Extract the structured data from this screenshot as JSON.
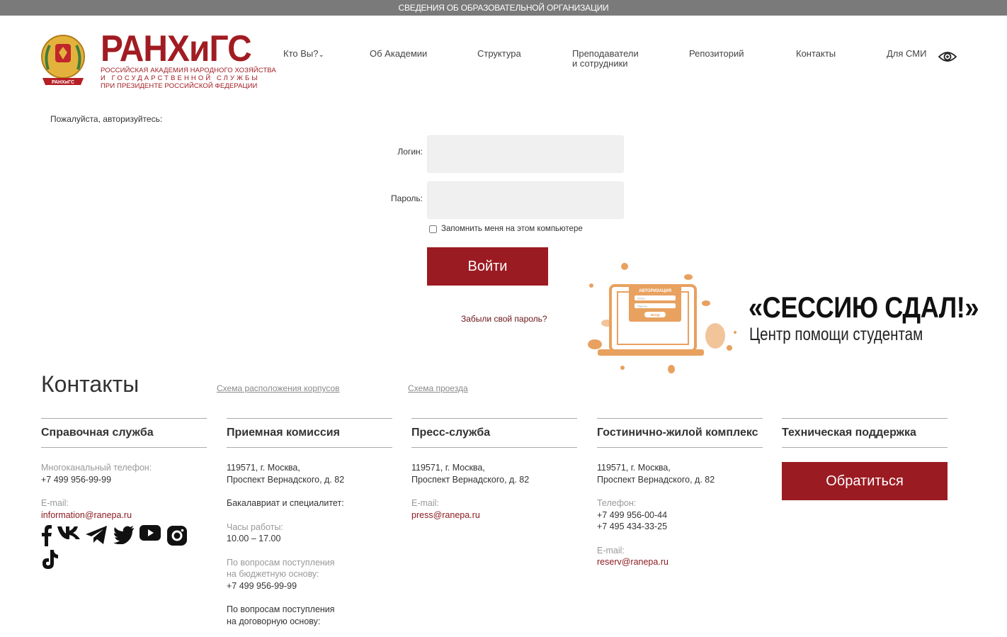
{
  "topbar": {
    "text": "СВЕДЕНИЯ ОБ ОБРАЗОВАТЕЛЬНОЙ ОРГАНИЗАЦИИ"
  },
  "logo": {
    "word": "РАНХиГС",
    "line1": "РОССИЙСКАЯ АКАДЕМИЯ НАРОДНОГО ХОЗЯЙСТВА",
    "line2": "И ГОСУДАРСТВЕННОЙ СЛУЖБЫ",
    "line3": "ПРИ ПРЕЗИДЕНТЕ РОССИЙСКОЙ ФЕДЕРАЦИИ",
    "emblem_text": "РАНХиГС"
  },
  "nav": {
    "who": "Кто Вы?",
    "about": "Об Академии",
    "structure": "Структура",
    "staff_line1": "Преподаватели",
    "staff_line2": "и сотрудники",
    "repository": "Репозиторий",
    "contacts": "Контакты",
    "media": "Для СМИ",
    "accessibility_icon": "eye-icon"
  },
  "auth": {
    "hint": "Пожалуйста, авторизуйтесь:",
    "login_label": "Логин:",
    "password_label": "Пароль:",
    "login_value": "",
    "password_value": "",
    "remember_label": "Запомнить меня на этом компьютере",
    "remember_checked": false,
    "submit": "Войти",
    "forgot": "Забыли свой пароль?"
  },
  "promo": {
    "title": "«СЕССИЮ СДАЛ!»",
    "subtitle": "Центр помощи студентам",
    "illustration": {
      "header": "АВТОРИЗАЦИЯ",
      "field1": "Логин",
      "field2": "Пароль",
      "button": "ВХОД"
    }
  },
  "contacts": {
    "title": "Контакты",
    "link_buildings": "Схема расположения корпусов",
    "link_directions": "Схема проезда",
    "info": {
      "title": "Справочная служба",
      "phone_label": "Многоканальный телефон:",
      "phone": "+7 499 956-99-99",
      "email_label": "E-mail:",
      "email": "information@ranepa.ru"
    },
    "admission": {
      "title": "Приемная комиссия",
      "addr1": "119571, г. Москва,",
      "addr2": "Проспект Вернадского, д. 82",
      "bachelor": "Бакалавриат и специалитет:",
      "hours_label": "Часы работы:",
      "hours": "10.00 – 17.00",
      "budget_label1": "По вопросам поступления",
      "budget_label2": "на бюджетную основу:",
      "budget_phone": "+7 499 956-99-99",
      "contract_label1": "По вопросам поступления",
      "contract_label2": "на договорную основу:"
    },
    "press": {
      "title": "Пресс-служба",
      "addr1": "119571, г. Москва,",
      "addr2": "Проспект Вернадского, д. 82",
      "email_label": "E-mail:",
      "email": "press@ranepa.ru"
    },
    "hotel": {
      "title": "Гостинично-жилой комплекс",
      "addr1": "119571, г. Москва,",
      "addr2": "Проспект Вернадского, д. 82",
      "phone_label": "Телефон:",
      "phone1": "+7 499 956-00-44",
      "phone2": "+7 495 434-33-25",
      "email_label": "E-mail:",
      "email": "reserv@ranepa.ru"
    },
    "support": {
      "title": "Техническая поддержка",
      "button": "Обратиться"
    }
  },
  "socials": [
    "facebook-icon",
    "vk-icon",
    "telegram-icon",
    "twitter-icon",
    "youtube-icon",
    "instagram-icon",
    "tiktok-icon"
  ],
  "colors": {
    "brand": "#9b1b22",
    "topbar": "#7a7a7a",
    "field": "#f0f0f0",
    "promo": "#e8a15f"
  }
}
